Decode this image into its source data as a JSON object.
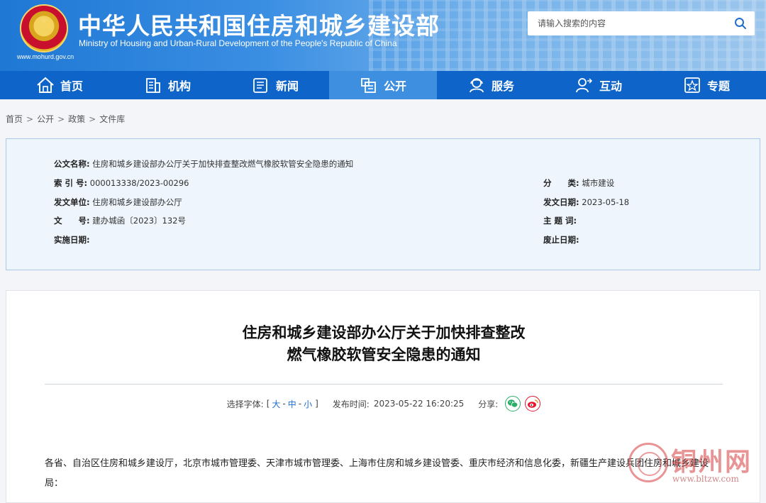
{
  "header": {
    "url": "www.mohurd.gov.cn",
    "title": "中华人民共和国住房和城乡建设部",
    "subtitle": "Ministry of Housing and Urban-Rural Development of the People's Republic of China",
    "search_placeholder": "请输入搜索的内容"
  },
  "nav": {
    "items": [
      {
        "label": "首页",
        "icon": "home-icon"
      },
      {
        "label": "机构",
        "icon": "building-icon"
      },
      {
        "label": "新闻",
        "icon": "news-icon"
      },
      {
        "label": "公开",
        "icon": "disclosure-icon",
        "active": true
      },
      {
        "label": "服务",
        "icon": "service-icon"
      },
      {
        "label": "互动",
        "icon": "interaction-icon"
      },
      {
        "label": "专题",
        "icon": "topic-icon"
      }
    ]
  },
  "breadcrumb": [
    "首页",
    "公开",
    "政策",
    "文件库"
  ],
  "meta": {
    "doc_name_label": "公文名称:",
    "doc_name": "住房和城乡建设部办公厅关于加快排查整改燃气橡胶软管安全隐患的通知",
    "index_label": "索 引 号:",
    "index": "000013338/2023-00296",
    "issuer_label": "发文单位:",
    "issuer": "住房和城乡建设部办公厅",
    "doc_no_label": "文　　号:",
    "doc_no": "建办城函〔2023〕132号",
    "effective_label": "实施日期:",
    "effective": "",
    "category_label": "分　　类:",
    "category": "城市建设",
    "issue_date_label": "发文日期:",
    "issue_date": "2023-05-18",
    "keywords_label": "主 题 词:",
    "keywords": "",
    "expire_label": "废止日期:",
    "expire": ""
  },
  "article": {
    "title_line1": "住房和城乡建设部办公厅关于加快排查整改",
    "title_line2": "燃气橡胶软管安全隐患的通知",
    "font_label": "选择字体:",
    "bracket_open": "[",
    "size_large": "大",
    "size_mid": "中",
    "size_small": "小",
    "bracket_close": "]",
    "dash": "-",
    "publish_label": "发布时间:",
    "publish_time": "2023-05-22 16:20:25",
    "share_label": "分享:",
    "body": "各省、自治区住房和城乡建设厅，北京市城市管理委、天津市城市管理委、上海市住房和城乡建设管委、重庆市经济和信息化委，新疆生产建设兵团住房和城乡建设局："
  },
  "watermark": {
    "text": "铜州网",
    "url": "www.bltzw.com"
  },
  "colors": {
    "nav_bg": "#0e64c9",
    "nav_active": "#3f8fe0",
    "link": "#1a6fd1",
    "meta_bg": "#eef5fc",
    "wechat": "#2aae67",
    "weibo": "#e6162d"
  }
}
